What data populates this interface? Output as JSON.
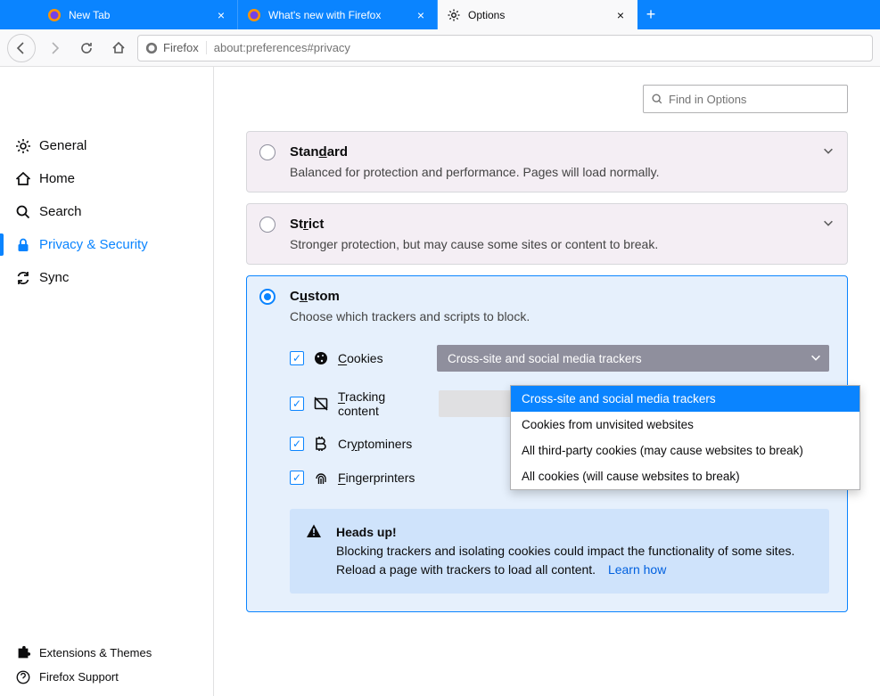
{
  "tabs": [
    {
      "label": "New Tab",
      "active": false,
      "favicon": "firefox"
    },
    {
      "label": "What's new with Firefox",
      "active": false,
      "favicon": "firefox"
    },
    {
      "label": "Options",
      "active": true,
      "favicon": "gear"
    }
  ],
  "url": {
    "identity": "Firefox",
    "address": "about:preferences#privacy"
  },
  "search": {
    "placeholder": "Find in Options"
  },
  "sidebar": {
    "items": [
      {
        "label": "General",
        "active": false
      },
      {
        "label": "Home",
        "active": false
      },
      {
        "label": "Search",
        "active": false
      },
      {
        "label": "Privacy & Security",
        "active": true
      },
      {
        "label": "Sync",
        "active": false
      }
    ],
    "bottom": [
      {
        "label": "Extensions & Themes"
      },
      {
        "label": "Firefox Support"
      }
    ]
  },
  "protection": {
    "standard": {
      "title": "Standard",
      "desc": "Balanced for protection and performance. Pages will load normally."
    },
    "strict": {
      "title": "Strict",
      "desc": "Stronger protection, but may cause some sites or content to break."
    },
    "custom": {
      "title": "Custom",
      "desc": "Choose which trackers and scripts to block.",
      "cookies_label": "Cookies",
      "cookies_select": "Cross-site and social media trackers",
      "tracking_label": "Tracking content",
      "crypto_label": "Cryptominers",
      "finger_label": "Fingerprinters",
      "dropdown": [
        "Cross-site and social media trackers",
        "Cookies from unvisited websites",
        "All third-party cookies (may cause websites to break)",
        "All cookies (will cause websites to break)"
      ]
    }
  },
  "alert": {
    "title": "Heads up!",
    "body": "Blocking trackers and isolating cookies could impact the functionality of some sites. Reload a page with trackers to load all content.",
    "link": "Learn how"
  }
}
